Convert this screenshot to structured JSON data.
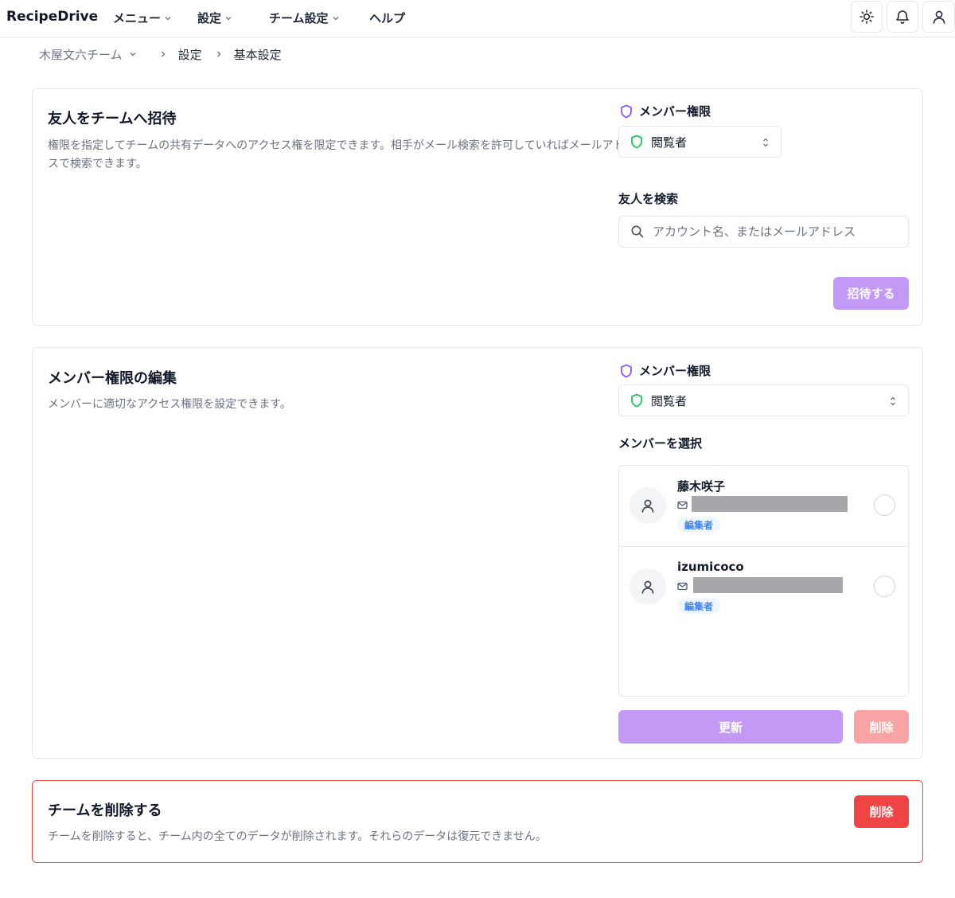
{
  "app": {
    "brand": "RecipeDrive"
  },
  "nav": {
    "menu": "メニュー",
    "settings": "設定",
    "team_settings": "チーム設定",
    "help": "ヘルプ"
  },
  "header_icons": [
    "sun-icon",
    "bell-icon",
    "user-icon"
  ],
  "breadcrumb": {
    "team": "木屋文六チーム",
    "settings": "設定",
    "current": "基本設定"
  },
  "invite": {
    "title": "友人をチームへ招待",
    "description_line1": "権限を指定してチームの共有データへのアクセス権を限定できます。相手がメール検索を許可していればメールアドレ",
    "description_line2": "スで検索できます。",
    "permission_label": "メンバー権限",
    "permission_value": "閲覧者",
    "search_label": "友人を検索",
    "search_placeholder": "アカウント名、またはメールアドレス",
    "search_value": "",
    "invite_button": "招待する"
  },
  "edit": {
    "title": "メンバー権限の編集",
    "description": "メンバーに適切なアクセス権限を設定できます。",
    "permission_label": "メンバー権限",
    "permission_value": "閲覧者",
    "select_label": "メンバーを選択",
    "members": [
      {
        "name": "藤木咲子",
        "role": "編集者"
      },
      {
        "name": "izumicoco",
        "role": "編集者"
      }
    ],
    "update_button": "更新",
    "delete_button": "削除"
  },
  "delete_team": {
    "title": "チームを削除する",
    "description": "チームを削除すると、チーム内の全てのデータが削除されます。それらのデータは復元できません。",
    "delete_button": "削除"
  },
  "colors": {
    "accent_purple": "#c29af5",
    "danger_red": "#ef4444",
    "danger_pink": "#f8a4a4",
    "shield_purple": "#8b5cf6",
    "shield_green": "#22c55e",
    "badge_blue": "#3b82f6"
  }
}
